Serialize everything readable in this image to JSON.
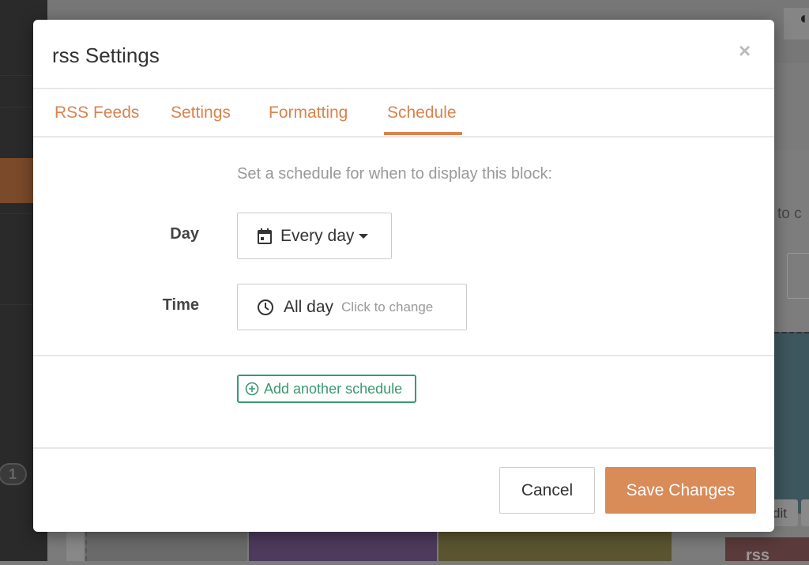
{
  "background": {
    "badge": "1",
    "partial_text": "to c",
    "edit_label": "dit",
    "block_label": "rss"
  },
  "modal": {
    "title": "rss Settings",
    "close": "×",
    "tabs": [
      {
        "label": "RSS Feeds",
        "active": false
      },
      {
        "label": "Settings",
        "active": false
      },
      {
        "label": "Formatting",
        "active": false
      },
      {
        "label": "Schedule",
        "active": true
      }
    ],
    "intro": "Set a schedule for when to display this block:",
    "day": {
      "label": "Day",
      "value": "Every day",
      "icon": "calendar-icon"
    },
    "time": {
      "label": "Time",
      "value": "All day",
      "hint": "Click to change",
      "icon": "clock-icon"
    },
    "add_schedule": "Add another schedule",
    "cancel": "Cancel",
    "save": "Save Changes"
  },
  "colors": {
    "accent": "#d9834f",
    "save": "#d98b58",
    "add": "#3a9873"
  }
}
